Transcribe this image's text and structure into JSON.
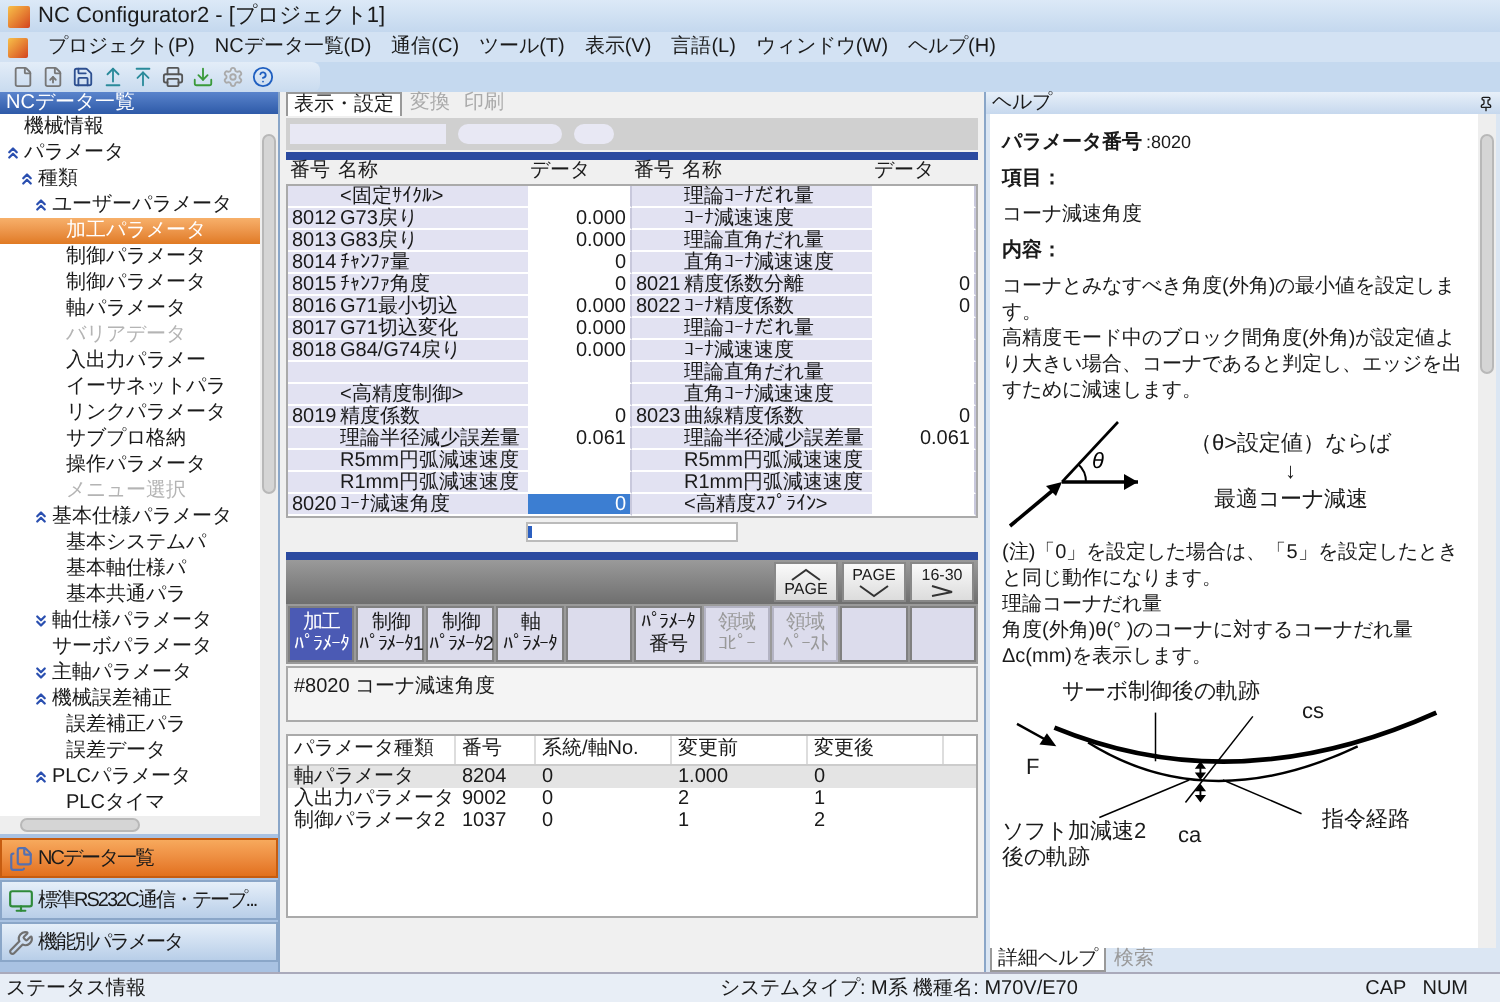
{
  "window": {
    "title": "NC Configurator2 - [プロジェクト1]"
  },
  "menu": [
    "プロジェクト(P)",
    "NCデータ一覧(D)",
    "通信(C)",
    "ツール(T)",
    "表示(V)",
    "言語(L)",
    "ウィンドウ(W)",
    "ヘルプ(H)"
  ],
  "sidebar": {
    "title": "NCデータ一覧",
    "tree": [
      {
        "label": "機械情報",
        "selected": false,
        "disabled": false
      },
      {
        "label": "パラメータ",
        "expanded": true,
        "selected": false,
        "disabled": false,
        "children": [
          {
            "label": "種類",
            "expanded": true,
            "selected": false,
            "disabled": false,
            "children": [
              {
                "label": "ユーザーパラメータ",
                "expanded": true,
                "selected": false,
                "disabled": false,
                "children": [
                  {
                    "label": "加工パラメータ",
                    "selected": true,
                    "disabled": false
                  },
                  {
                    "label": "制御パラメータ",
                    "selected": false,
                    "disabled": false
                  },
                  {
                    "label": "制御パラメータ",
                    "selected": false,
                    "disabled": false
                  },
                  {
                    "label": "軸パラメータ",
                    "selected": false,
                    "disabled": false
                  },
                  {
                    "label": "バリアデータ",
                    "selected": false,
                    "disabled": true
                  },
                  {
                    "label": "入出力パラメー",
                    "selected": false,
                    "disabled": false
                  },
                  {
                    "label": "イーサネットパラ",
                    "selected": false,
                    "disabled": false
                  },
                  {
                    "label": "リンクパラメータ",
                    "selected": false,
                    "disabled": false
                  },
                  {
                    "label": "サブプロ格納",
                    "selected": false,
                    "disabled": false
                  },
                  {
                    "label": "操作パラメータ",
                    "selected": false,
                    "disabled": false
                  },
                  {
                    "label": "メニュー選択",
                    "selected": false,
                    "disabled": true
                  }
                ]
              },
              {
                "label": "基本仕様パラメータ",
                "expanded": true,
                "selected": false,
                "disabled": false,
                "children": [
                  {
                    "label": "基本システムパ",
                    "selected": false,
                    "disabled": false
                  },
                  {
                    "label": "基本軸仕様パ",
                    "selected": false,
                    "disabled": false
                  },
                  {
                    "label": "基本共通パラ",
                    "selected": false,
                    "disabled": false
                  }
                ]
              },
              {
                "label": "軸仕様パラメータ",
                "expanded": false,
                "selected": false,
                "disabled": false
              },
              {
                "label": "サーボパラメータ",
                "selected": false,
                "disabled": false
              },
              {
                "label": "主軸パラメータ",
                "expanded": false,
                "selected": false,
                "disabled": false
              },
              {
                "label": "機械誤差補正",
                "expanded": true,
                "selected": false,
                "disabled": false,
                "children": [
                  {
                    "label": "誤差補正パラ",
                    "selected": false,
                    "disabled": false
                  },
                  {
                    "label": "誤差データ",
                    "selected": false,
                    "disabled": false
                  }
                ]
              },
              {
                "label": "PLCパラメータ",
                "expanded": true,
                "selected": false,
                "disabled": false,
                "children": [
                  {
                    "label": "PLCタイマ",
                    "selected": false,
                    "disabled": false
                  }
                ]
              }
            ]
          }
        ]
      }
    ],
    "nav": [
      {
        "label": "NCデータ一覧",
        "kind": "list",
        "selected": true
      },
      {
        "label": "標準RS232C通信・テープ...",
        "kind": "comm",
        "selected": false
      },
      {
        "label": "機能別パラメータ",
        "kind": "tools",
        "selected": false
      }
    ]
  },
  "editor": {
    "tabs": [
      {
        "label": "表示・設定",
        "selected": true,
        "disabled": false
      },
      {
        "label": "変換",
        "selected": false,
        "disabled": true
      },
      {
        "label": "印刷",
        "selected": false,
        "disabled": true
      }
    ],
    "columns": [
      "番号",
      "名称",
      "データ",
      "番号",
      "名称",
      "データ"
    ],
    "rows": [
      {
        "left": {
          "name": "<固定ｻｲｸﾙ>"
        },
        "right": {
          "name": "理論ｺｰﾅだれ量"
        },
        "selected": false
      },
      {
        "left": {
          "no": "8012",
          "name": "G73戻り",
          "data": "0.000"
        },
        "right": {
          "name": "ｺｰﾅ減速速度"
        },
        "selected": false
      },
      {
        "left": {
          "no": "8013",
          "name": "G83戻り",
          "data": "0.000"
        },
        "right": {
          "name": "理論直角だれ量"
        },
        "selected": false
      },
      {
        "left": {
          "no": "8014",
          "name": "ﾁｬﾝﾌｧ量",
          "data": "0"
        },
        "right": {
          "name": "直角ｺｰﾅ減速速度"
        },
        "selected": false
      },
      {
        "left": {
          "no": "8015",
          "name": "ﾁｬﾝﾌｧ角度",
          "data": "0"
        },
        "right": {
          "no": "8021",
          "name": "精度係数分離",
          "data": "0"
        },
        "selected": false
      },
      {
        "left": {
          "no": "8016",
          "name": "G71最小切込",
          "data": "0.000"
        },
        "right": {
          "no": "8022",
          "name": "ｺｰﾅ精度係数",
          "data": "0"
        },
        "selected": false
      },
      {
        "left": {
          "no": "8017",
          "name": "G71切込変化",
          "data": "0.000"
        },
        "right": {
          "name": "理論ｺｰﾅだれ量"
        },
        "selected": false
      },
      {
        "left": {
          "no": "8018",
          "name": "G84/G74戻り",
          "data": "0.000"
        },
        "right": {
          "name": "ｺｰﾅ減速速度"
        },
        "selected": false
      },
      {
        "right": {
          "name": "理論直角だれ量"
        },
        "selected": false
      },
      {
        "left": {
          "name": "<高精度制御>"
        },
        "right": {
          "name": "直角ｺｰﾅ減速速度"
        },
        "selected": false
      },
      {
        "left": {
          "no": "8019",
          "name": "精度係数",
          "data": "0"
        },
        "right": {
          "no": "8023",
          "name": "曲線精度係数",
          "data": "0"
        },
        "selected": false
      },
      {
        "left": {
          "name": "理論半径減少誤差量",
          "data": "0.061"
        },
        "right": {
          "name": "理論半径減少誤差量",
          "data": "0.061"
        },
        "selected": false
      },
      {
        "left": {
          "name": "R5mm円弧減速速度"
        },
        "right": {
          "name": "R5mm円弧減速速度"
        },
        "selected": false
      },
      {
        "left": {
          "name": "R1mm円弧減速速度"
        },
        "right": {
          "name": "R1mm円弧減速速度"
        },
        "selected": false
      },
      {
        "left": {
          "no": "8020",
          "name": "ｺｰﾅ減速角度",
          "data": "0"
        },
        "right": {
          "name": "<高精度ｽﾌﾟﾗｲﾝ>"
        },
        "selected": true
      }
    ],
    "page_buttons": [
      {
        "label": "PAGE",
        "kind": "up"
      },
      {
        "label": "PAGE",
        "kind": "down"
      },
      {
        "label": "16-30",
        "kind": "next"
      }
    ],
    "keys": [
      {
        "kind": "label",
        "lines": [
          "加工",
          "ﾊﾟﾗﾒｰﾀ"
        ],
        "selected": true,
        "disabled": false
      },
      {
        "kind": "label",
        "lines": [
          "制御",
          "ﾊﾟﾗﾒｰﾀ1"
        ],
        "selected": false,
        "disabled": false
      },
      {
        "kind": "label",
        "lines": [
          "制御",
          "ﾊﾟﾗﾒｰﾀ2"
        ],
        "selected": false,
        "disabled": false
      },
      {
        "kind": "label",
        "lines": [
          "軸",
          "ﾊﾟﾗﾒｰﾀ"
        ],
        "selected": false,
        "disabled": false
      },
      {
        "kind": "blank",
        "selected": false,
        "disabled": false
      },
      {
        "kind": "label",
        "lines": [
          "ﾊﾟﾗﾒｰﾀ",
          "番号"
        ],
        "selected": false,
        "disabled": false
      },
      {
        "kind": "label",
        "lines": [
          "領域",
          "ｺﾋﾟｰ"
        ],
        "selected": false,
        "disabled": true
      },
      {
        "kind": "label",
        "lines": [
          "領域",
          "ﾍﾟｰｽﾄ"
        ],
        "selected": false,
        "disabled": true
      },
      {
        "kind": "blank",
        "selected": false,
        "disabled": false
      },
      {
        "kind": "blank",
        "selected": false,
        "disabled": false
      }
    ],
    "message": "#8020 コーナ減速角度",
    "history": {
      "columns": [
        "パラメータ種類",
        "番号",
        "系統/軸No.",
        "変更前",
        "変更後"
      ],
      "rows": [
        {
          "cells": [
            "軸パラメータ",
            "8204",
            "0",
            "1.000",
            "0"
          ],
          "selected": true
        },
        {
          "cells": [
            "入出力パラメータ",
            "9002",
            "0",
            "2",
            "1"
          ],
          "selected": false
        },
        {
          "cells": [
            "制御パラメータ2",
            "1037",
            "0",
            "1",
            "2"
          ],
          "selected": false
        }
      ]
    }
  },
  "help": {
    "title": "ヘルプ",
    "param_label": "パラメータ番号",
    "param_value": ":8020",
    "item_label": "項目：",
    "item_value": "コーナ減速角度",
    "content_label": "内容：",
    "paragraphs": [
      "コーナとみなすべき角度(外角)の最小値を設定します。",
      "高精度モード中のブロック間角度(外角)が設定値より大きい場合、コーナであると判定し、エッジを出すために減速します。"
    ],
    "diagram1": {
      "angle": "θ",
      "condition": "（θ>設定値）ならば",
      "arrow": "↓",
      "result": "最適コーナ減速"
    },
    "notes": [
      "(注)「0」を設定した場合は、「5」を設定したときと同じ動作になります。",
      "理論コーナだれ量",
      "角度(外角)θ(° )のコーナに対するコーナだれ量Δc(mm)を表示します。"
    ],
    "diagram2": {
      "servo": "サーボ制御後の軌跡",
      "cs": "cs",
      "feed": "F",
      "soft_1": "ソフト加減速2",
      "soft_2": "後の軌跡",
      "ca": "ca",
      "command": "指令経路"
    },
    "tabs": [
      {
        "label": "詳細ヘルプ",
        "selected": true
      },
      {
        "label": "検索",
        "selected": false
      }
    ]
  },
  "status_bar": {
    "left": "ステータス情報",
    "system": "システムタイプ: M系 機種名: M70V/E70",
    "indicators": [
      "CAP",
      "NUM"
    ]
  }
}
